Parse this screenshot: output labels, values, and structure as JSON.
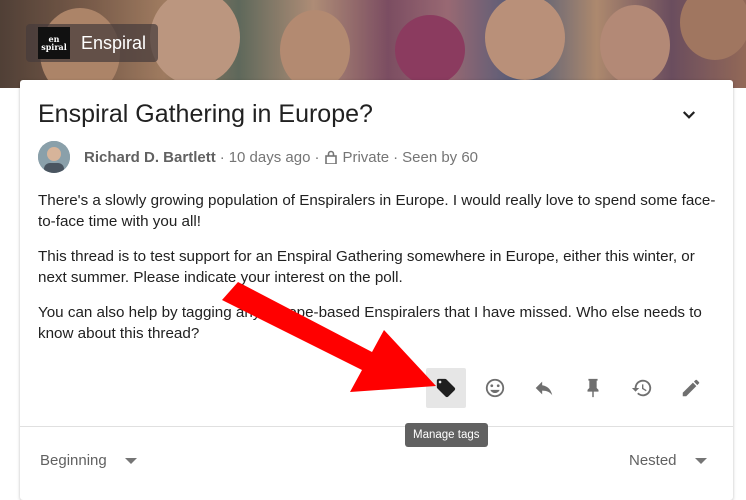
{
  "group": {
    "name": "Enspiral",
    "logo_text_top": "en",
    "logo_text_bottom": "spiral"
  },
  "thread": {
    "title": "Enspiral Gathering in Europe?",
    "author": "Richard D. Bartlett",
    "time": "10 days ago",
    "privacy": "Private",
    "seen_by": "Seen by 60",
    "separator": "·",
    "paragraphs": [
      "There's a slowly growing population of Enspiralers in Europe. I would really love to spend some face-to-face time with you all!",
      "This thread is to test support for an Enspiral Gathering somewhere in Europe, either this winter, or next summer. Please indicate your interest on the poll.",
      "You can also help by tagging any Europe-based Enspiralers that I have missed. Who else needs to know about this thread?"
    ]
  },
  "actions": {
    "tooltip": "Manage tags",
    "icons": [
      "tag-icon",
      "emoji-icon",
      "reply-icon",
      "pin-icon",
      "history-icon",
      "edit-icon"
    ]
  },
  "sort": {
    "left_label": "Beginning",
    "right_label": "Nested"
  },
  "colors": {
    "arrow": "#ff0000",
    "tooltip_bg": "#616161"
  }
}
